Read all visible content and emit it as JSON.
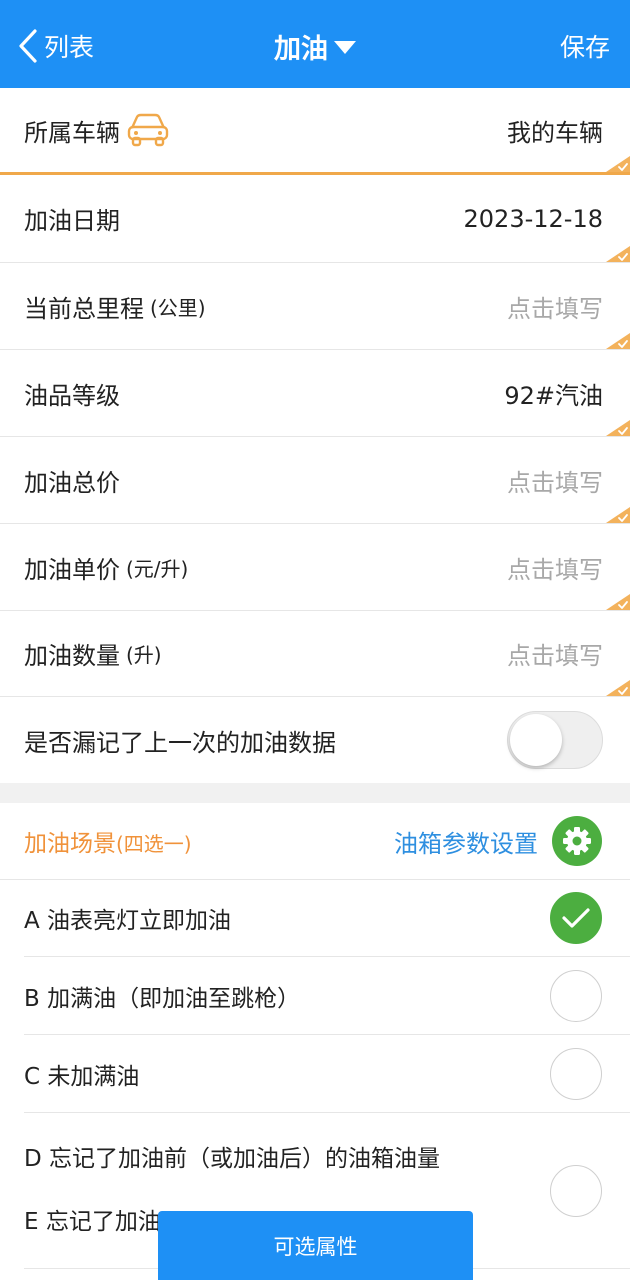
{
  "header": {
    "back_label": "列表",
    "title": "加油",
    "save_label": "保存"
  },
  "form": {
    "vehicle": {
      "label": "所属车辆",
      "value": "我的车辆"
    },
    "date": {
      "label": "加油日期",
      "value": "2023-12-18"
    },
    "mileage": {
      "label": "当前总里程",
      "unit": "(公里)",
      "placeholder": "点击填写"
    },
    "fuel_grade": {
      "label": "油品等级",
      "value": "92#汽油"
    },
    "total_price": {
      "label": "加油总价",
      "placeholder": "点击填写"
    },
    "unit_price": {
      "label": "加油单价",
      "unit": "(元/升)",
      "placeholder": "点击填写"
    },
    "quantity": {
      "label": "加油数量",
      "unit": "(升)",
      "placeholder": "点击填写"
    },
    "missed_previous": {
      "label": "是否漏记了上一次的加油数据",
      "on": false
    }
  },
  "scene": {
    "title": "加油场景",
    "subtitle": "(四选一)",
    "tank_settings_label": "油箱参数设置",
    "selected_index": 0,
    "options": [
      {
        "label": "A 油表亮灯立即加油"
      },
      {
        "label": "B 加满油（即加油至跳枪）"
      },
      {
        "label": "C 未加满油"
      },
      {
        "label": "D 忘记了加油前（或加油后）的油箱油量"
      },
      {
        "label": "E 忘记了加油"
      }
    ]
  },
  "bottom_button": {
    "label": "可选属性"
  },
  "colors": {
    "primary": "#1e90f5",
    "accent_orange": "#f0923a",
    "green": "#4cae40",
    "link_blue": "#2e8fe0",
    "placeholder_gray": "#a8a8a8"
  },
  "icons": {
    "back": "chevron-left-icon",
    "title_dropdown": "caret-down-icon",
    "vehicle": "car-icon",
    "settings": "gear-icon",
    "selected": "check-icon",
    "row_corner": "check-corner-icon"
  }
}
